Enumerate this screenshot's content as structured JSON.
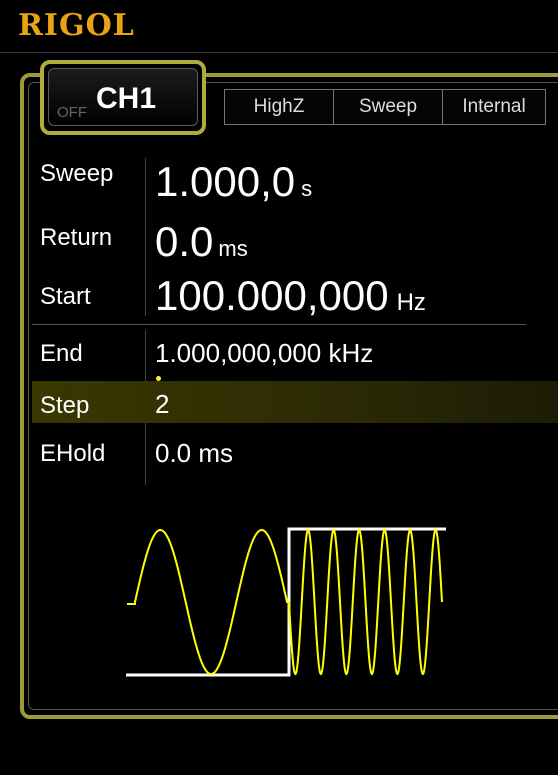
{
  "brand": "RIGOL",
  "channel": {
    "state": "OFF",
    "name": "CH1"
  },
  "status_tags": [
    "HighZ",
    "Sweep",
    "Internal"
  ],
  "params": {
    "sweep": {
      "label": "Sweep",
      "value": "1.000,0",
      "unit": "s"
    },
    "return": {
      "label": "Return",
      "value": "0.0",
      "unit": "ms"
    },
    "start": {
      "label": "Start",
      "value": "100.000,000",
      "unit": "Hz"
    },
    "end": {
      "label": "End",
      "value": "1.000,000,000 kHz"
    },
    "step": {
      "label": "Step",
      "value": "2"
    },
    "ehold": {
      "label": "EHold",
      "value": "0.0 ms"
    }
  },
  "selected_param": "Step",
  "colors": {
    "accent": "#e8a317",
    "frame": "#9c9a3a",
    "wave": "#ffff00",
    "highlight": "#3a3800"
  }
}
